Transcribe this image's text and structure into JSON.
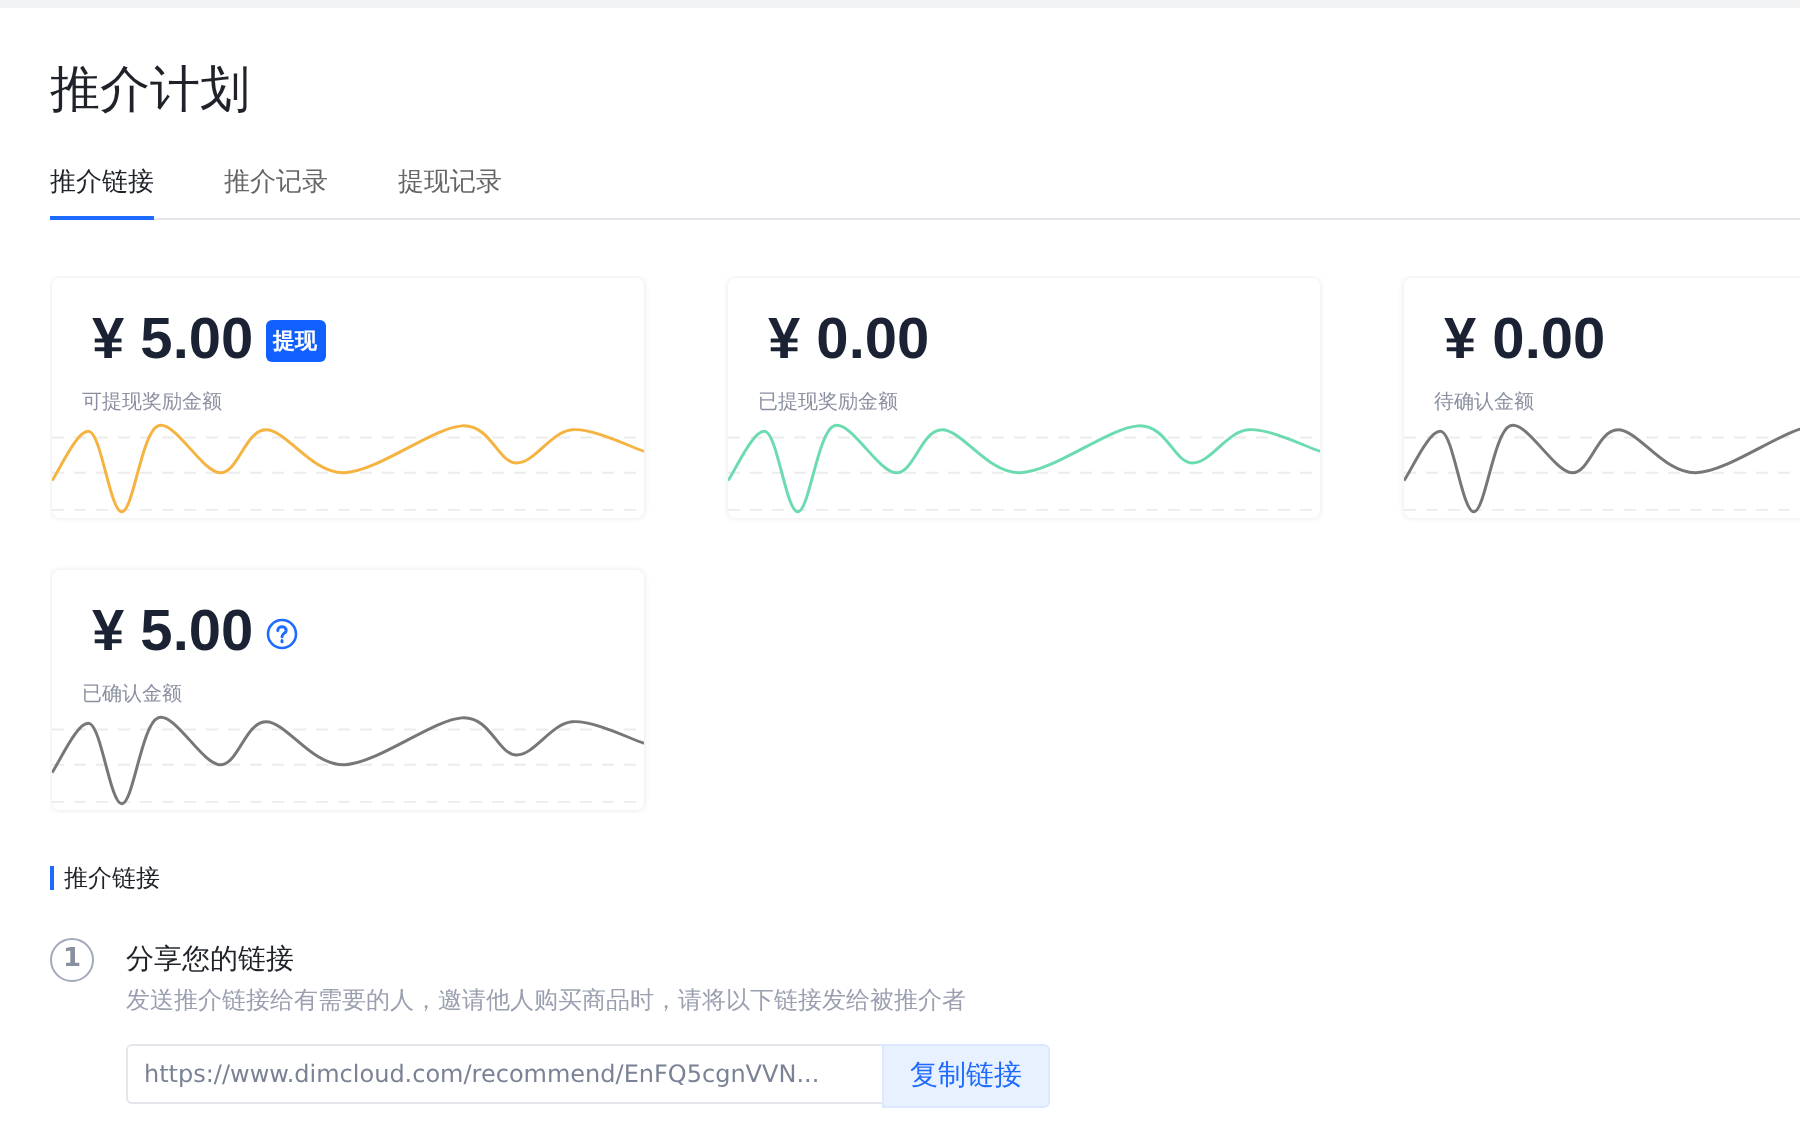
{
  "page": {
    "title": "推介计划"
  },
  "tabs": [
    {
      "label": "推介链接",
      "selected": true
    },
    {
      "label": "推介记录",
      "selected": false
    },
    {
      "label": "提现记录",
      "selected": false
    }
  ],
  "cards": [
    {
      "amount": "¥ 5.00",
      "label": "可提现奖励金额",
      "color": "#f5b342",
      "button": "提现",
      "help_icon": false
    },
    {
      "amount": "¥ 0.00",
      "label": "已提现奖励金额",
      "color": "#6cdcb0",
      "help_icon": false
    },
    {
      "amount": "¥ 0.00",
      "label": "待确认金额",
      "color": "#777777",
      "help_icon": false
    },
    {
      "amount": "¥ 5.00",
      "label": "已确认金额",
      "color": "#777777",
      "help_icon": true
    }
  ],
  "section": {
    "title": "推介链接"
  },
  "steps": [
    {
      "number": "1",
      "title": "分享您的链接",
      "description": "发送推介链接给有需要的人，邀请他人购买商品时，请将以下链接发给被推介者",
      "link": "https://www.dimcloud.com/recommend/EnFQ5cgnVVN...",
      "button": "复制链接"
    }
  ]
}
